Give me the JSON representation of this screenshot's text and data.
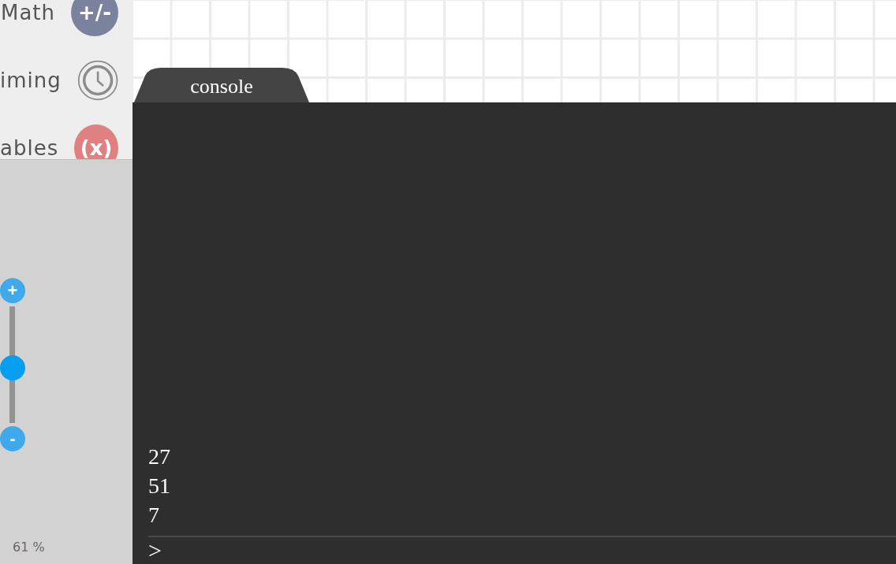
{
  "categories": [
    {
      "label": "Math",
      "kind": "text",
      "icon_text": "+/-",
      "color": "#7a829e"
    },
    {
      "label": "iming",
      "kind": "clock",
      "color": "#8c8c8c"
    },
    {
      "label": "ables",
      "kind": "text",
      "icon_text": "(x)",
      "color": "#e08080"
    }
  ],
  "zoom": {
    "plus": "+",
    "minus": "-",
    "level": 0.47,
    "reading": "61 %"
  },
  "console": {
    "tab": "console",
    "lines": [
      "27",
      "51",
      "7"
    ],
    "prompt": ">"
  }
}
